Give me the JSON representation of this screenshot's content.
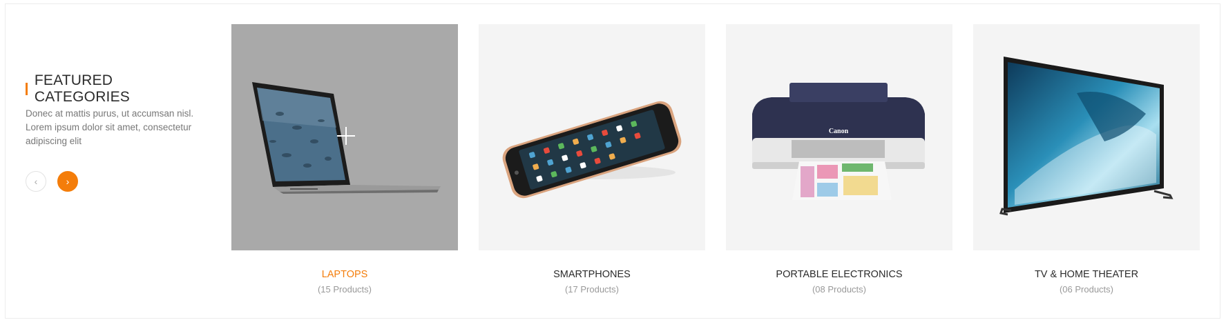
{
  "section": {
    "title": "FEATURED CATEGORIES",
    "description": "Donec at mattis purus, ut accumsan nisl. Lorem ipsum dolor sit amet, consectetur adipiscing elit",
    "prev_icon": "chevron-left-icon",
    "next_icon": "chevron-right-icon",
    "prev_glyph": "‹",
    "next_glyph": "›"
  },
  "colors": {
    "accent": "#f47d0a",
    "text": "#2b2b2b",
    "muted": "#999999",
    "tile_bg": "#f4f4f4",
    "tile_hover": "#a9a9a9"
  },
  "categories": [
    {
      "name": "LAPTOPS",
      "count": "(15 Products)",
      "image": "laptop-image",
      "active": true
    },
    {
      "name": "SMARTPHONES",
      "count": "(17 Products)",
      "image": "smartphone-image",
      "active": false
    },
    {
      "name": "PORTABLE ELECTRONICS",
      "count": "(08 Products)",
      "image": "printer-image",
      "active": false
    },
    {
      "name": "TV & HOME THEATER",
      "count": "(06 Products)",
      "image": "tv-image",
      "active": false
    }
  ],
  "printer_brand": "Canon"
}
